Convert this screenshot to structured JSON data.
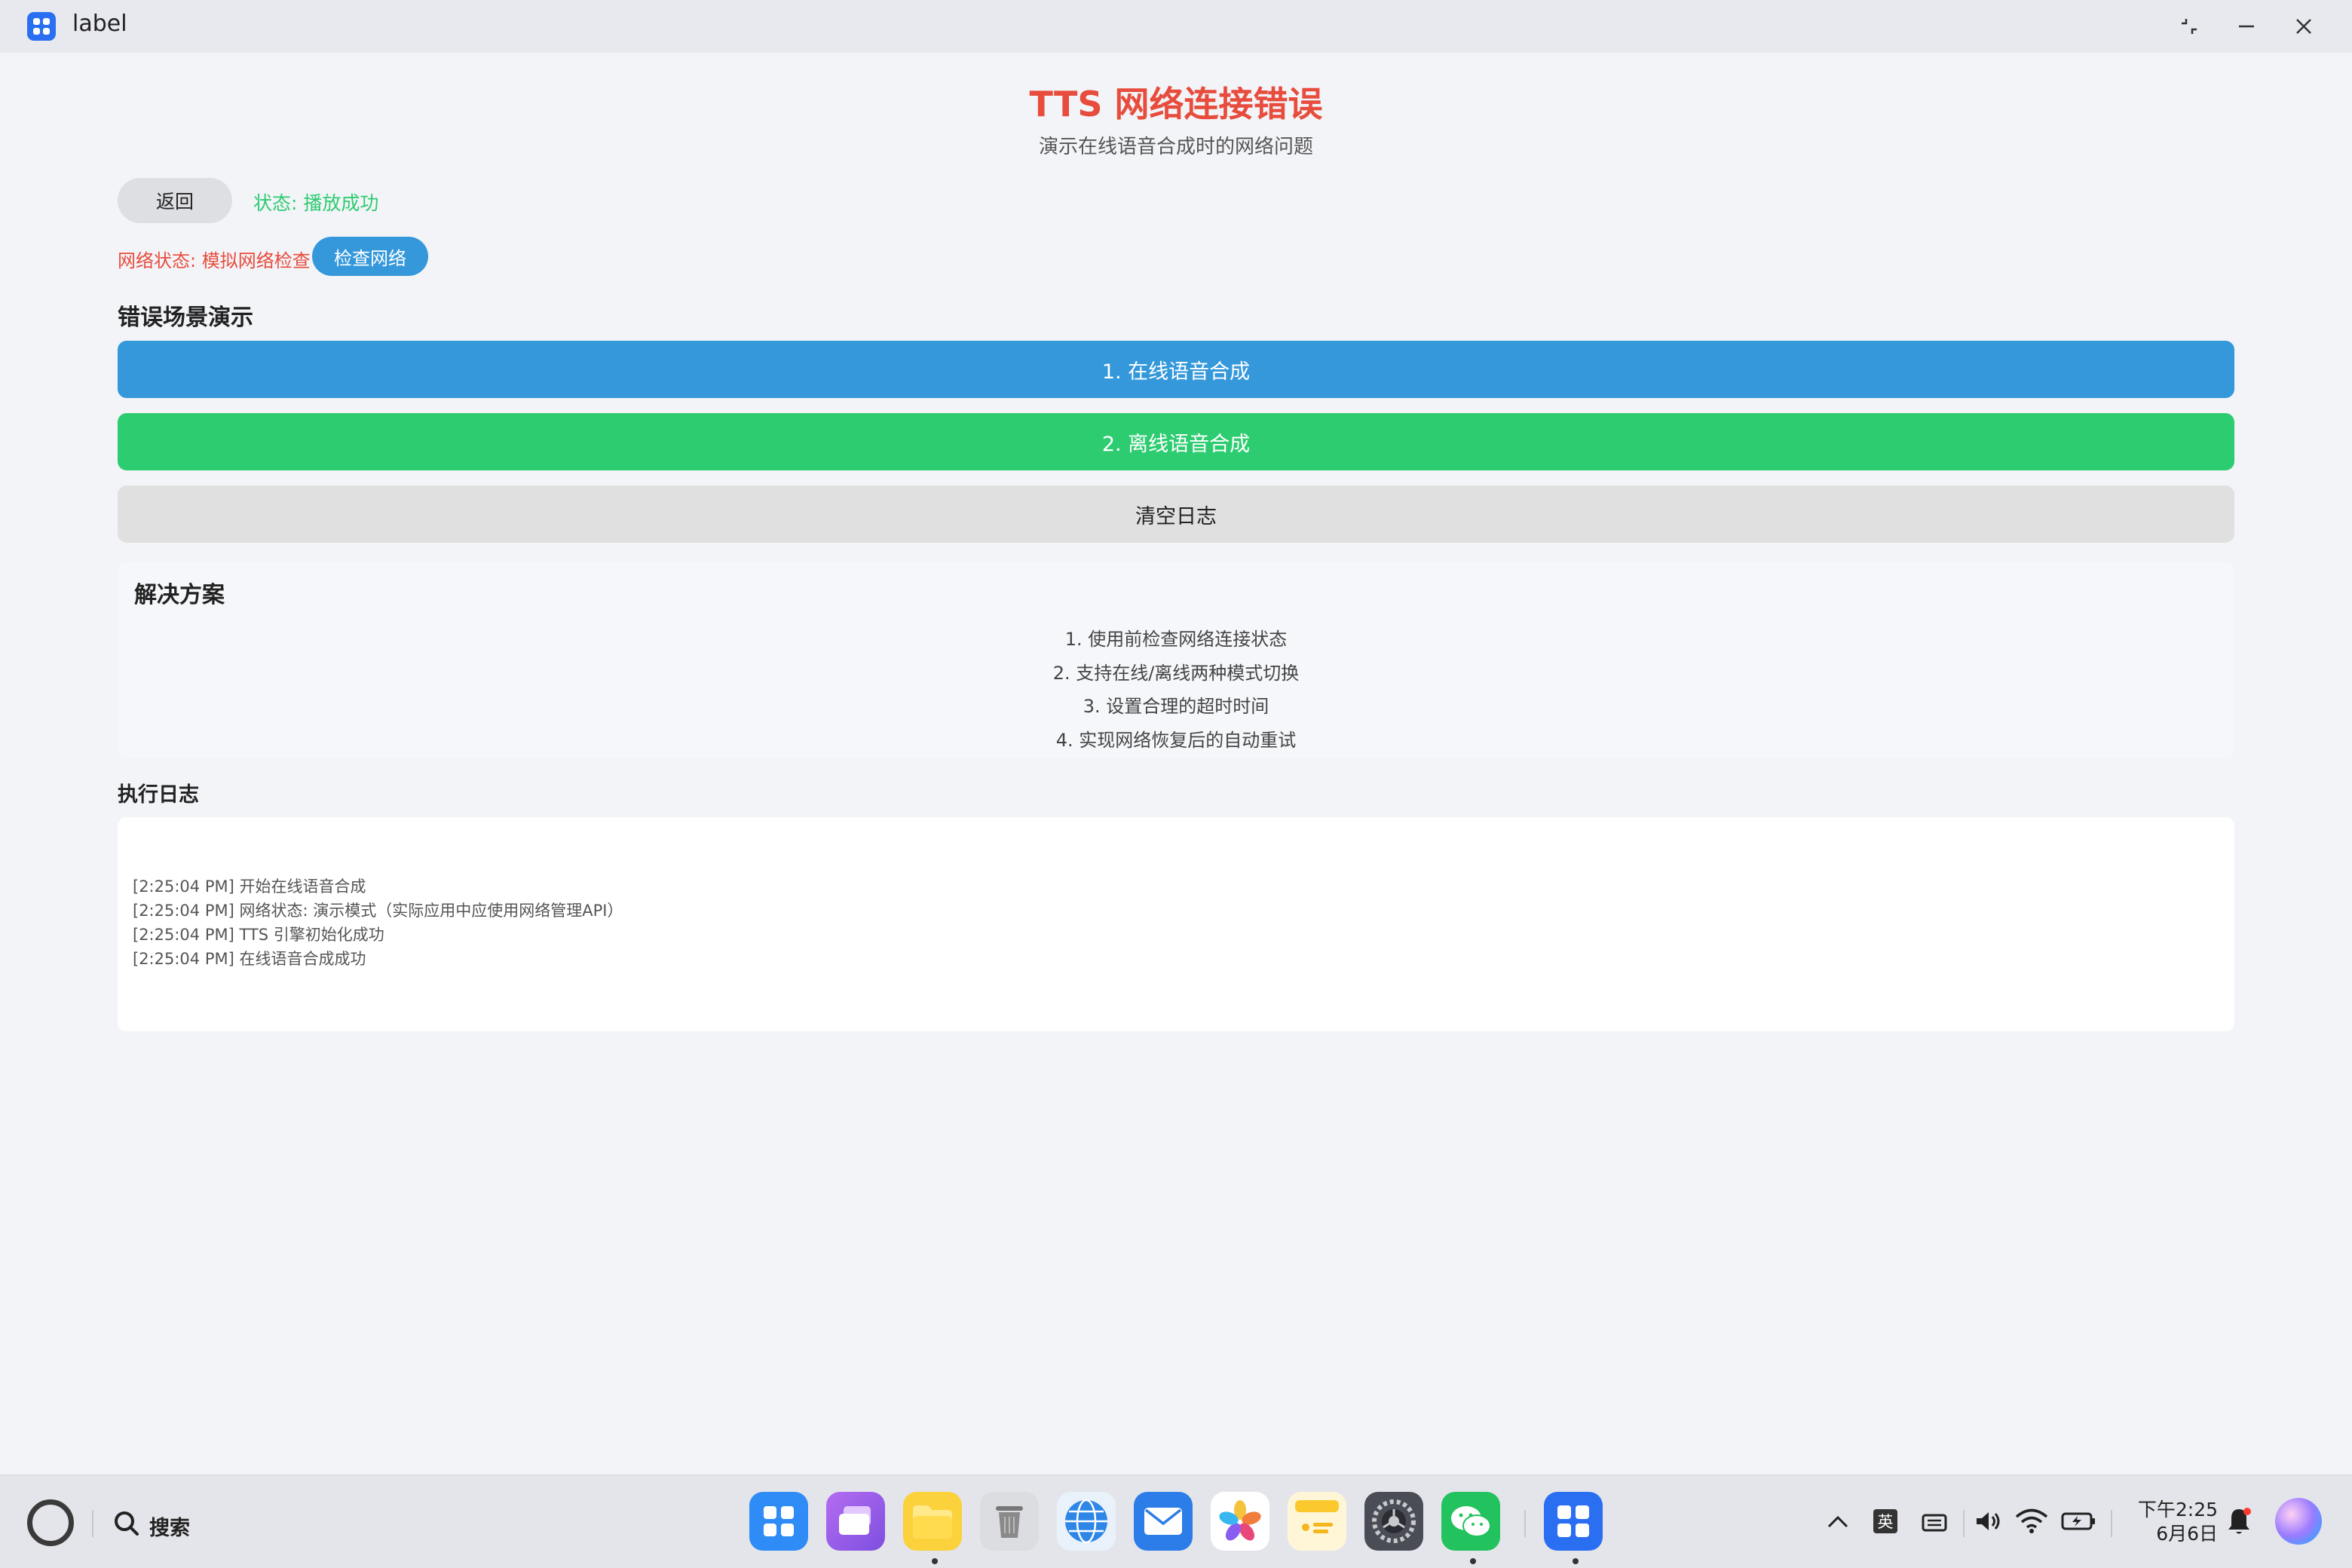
{
  "window": {
    "title": "label"
  },
  "header": {
    "title": "TTS 网络连接错误",
    "subtitle": "演示在线语音合成时的网络问题"
  },
  "controls": {
    "back_label": "返回",
    "status": "状态: 播放成功",
    "network_status": "网络状态: 模拟网络检查",
    "check_network_label": "检查网络"
  },
  "scenarios": {
    "title": "错误场景演示",
    "online_label": "1. 在线语音合成",
    "offline_label": "2. 离线语音合成",
    "clear_label": "清空日志"
  },
  "solutions": {
    "title": "解决方案",
    "items": [
      "1. 使用前检查网络连接状态",
      "2. 支持在线/离线两种模式切换",
      "3. 设置合理的超时时间",
      "4. 实现网络恢复后的自动重试"
    ]
  },
  "log": {
    "title": "执行日志",
    "lines": [
      "[2:25:04 PM] 开始在线语音合成",
      "[2:25:04 PM] 网络状态: 演示模式（实际应用中应使用网络管理API）",
      "[2:25:04 PM] TTS 引擎初始化成功",
      "[2:25:04 PM] 在线语音合成成功"
    ]
  },
  "taskbar": {
    "search_label": "搜索",
    "ime_label": "英",
    "clock_time": "下午2:25",
    "clock_date": "6月6日",
    "dock": [
      "app-center-icon",
      "multitask-icon",
      "files-icon",
      "trash-icon",
      "browser-icon",
      "mail-icon",
      "photos-icon",
      "notes-icon",
      "settings-icon",
      "wechat-icon",
      "label-app-icon"
    ]
  },
  "colors": {
    "title_red": "#e74c3c",
    "success_green": "#2ecc71",
    "primary_blue": "#3498db"
  }
}
